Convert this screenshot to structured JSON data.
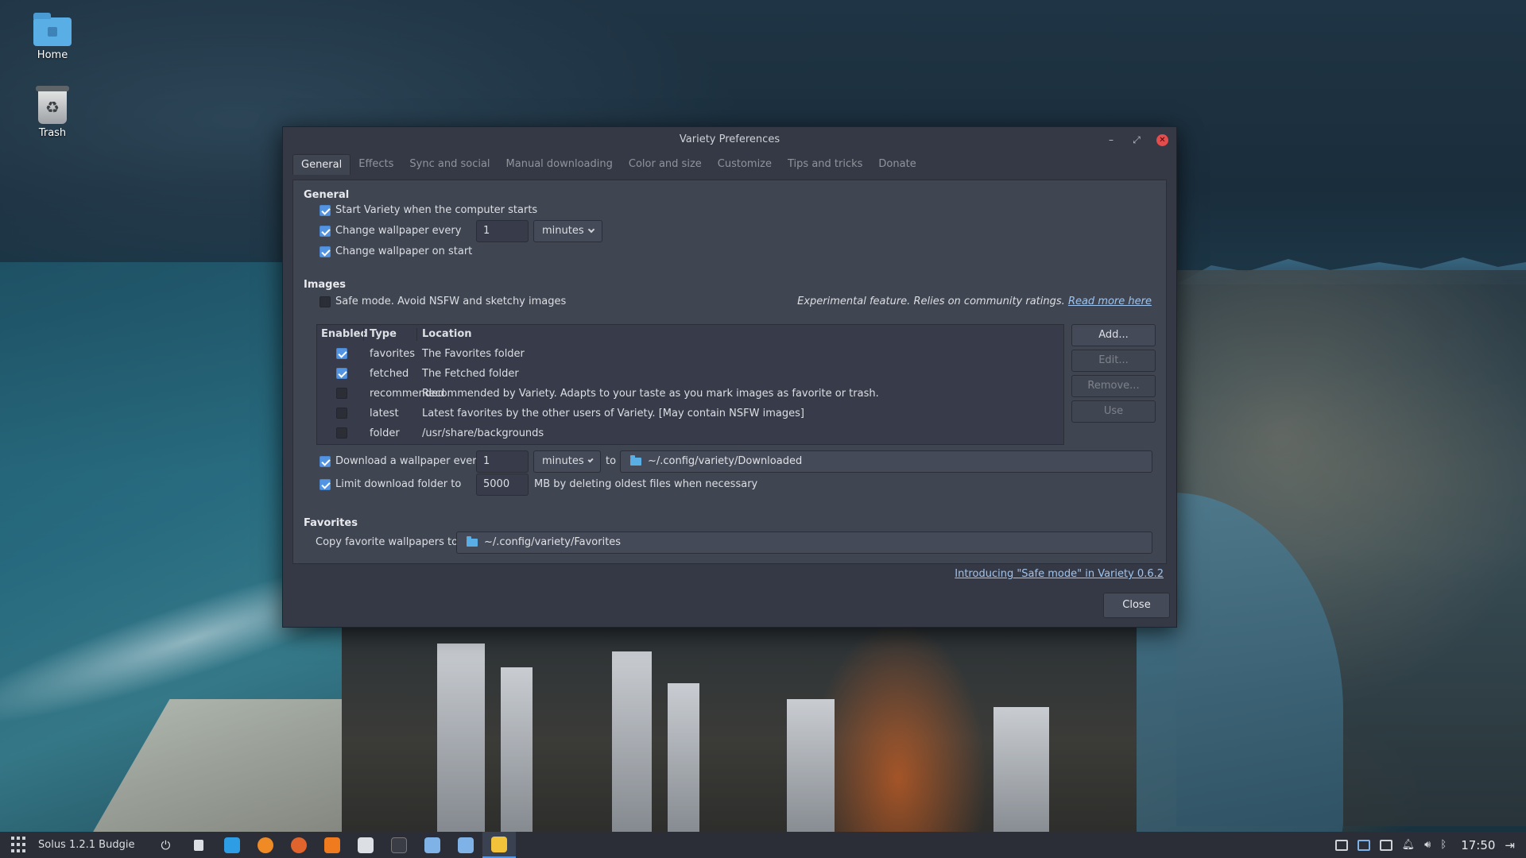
{
  "desktop": {
    "icons": [
      {
        "label": "Home"
      },
      {
        "label": "Trash"
      }
    ]
  },
  "window": {
    "title": "Variety Preferences",
    "controls": {
      "minimize": "–",
      "restore": "⤢",
      "close": "✕"
    },
    "tabs": [
      "General",
      "Effects",
      "Sync and social",
      "Manual downloading",
      "Color and size",
      "Customize",
      "Tips and tricks",
      "Donate"
    ],
    "active_tab": "General"
  },
  "general": {
    "title": "General",
    "start_on_boot": {
      "label": "Start Variety when the computer starts",
      "checked": true
    },
    "change_every": {
      "label": "Change wallpaper every",
      "checked": true,
      "value": "1",
      "unit": "minutes"
    },
    "change_on_start": {
      "label": "Change wallpaper on start",
      "checked": true
    }
  },
  "images": {
    "title": "Images",
    "safe_mode": {
      "label": "Safe mode. Avoid NSFW and sketchy images",
      "checked": false
    },
    "safe_note": "Experimental feature. Relies on community ratings.",
    "safe_link": "Read more here",
    "table": {
      "headers": [
        "Enabled",
        "Type",
        "Location"
      ],
      "rows": [
        {
          "enabled": true,
          "type": "favorites",
          "location": "The Favorites folder"
        },
        {
          "enabled": true,
          "type": "fetched",
          "location": "The Fetched folder"
        },
        {
          "enabled": false,
          "type": "recommended",
          "location": "Recommended by Variety. Adapts to your taste as you mark images as favorite or trash."
        },
        {
          "enabled": false,
          "type": "latest",
          "location": "Latest favorites by the other users of Variety. [May contain NSFW images]"
        },
        {
          "enabled": false,
          "type": "folder",
          "location": "/usr/share/backgrounds"
        }
      ]
    },
    "buttons": {
      "add": "Add...",
      "edit": "Edit...",
      "remove": "Remove...",
      "use": "Use"
    },
    "download": {
      "label": "Download a wallpaper every",
      "checked": true,
      "value": "1",
      "unit": "minutes",
      "to": "to",
      "folder": "~/.config/variety/Downloaded"
    },
    "limit": {
      "label": "Limit download folder to",
      "checked": true,
      "value": "5000",
      "suffix": "MB by deleting oldest files when necessary"
    }
  },
  "favorites": {
    "title": "Favorites",
    "copy_label": "Copy favorite wallpapers to",
    "folder": "~/.config/variety/Favorites"
  },
  "footer": {
    "link": "Introducing \"Safe mode\" in Variety 0.6.2",
    "close": "Close"
  },
  "taskbar": {
    "title": "Solus 1.2.1 Budgie",
    "apps": [
      {
        "name": "power-icon",
        "color": "#dcdfe3"
      },
      {
        "name": "files-icon",
        "color": "#dcdfe3"
      },
      {
        "name": "download-icon",
        "color": "#2d9de6"
      },
      {
        "name": "firefox-icon",
        "color": "#f08a24"
      },
      {
        "name": "media-icon",
        "color": "#e0642c"
      },
      {
        "name": "player-icon",
        "color": "#f07b1e"
      },
      {
        "name": "music-icon",
        "color": "#dcdfe3"
      },
      {
        "name": "terminal-icon",
        "color": "#3a3d45"
      },
      {
        "name": "screenshot-icon",
        "color": "#7fb3e8"
      },
      {
        "name": "camera-icon",
        "color": "#7fb3e8"
      },
      {
        "name": "variety-icon",
        "color": "#f2c23a"
      }
    ],
    "clock": "17:50"
  }
}
